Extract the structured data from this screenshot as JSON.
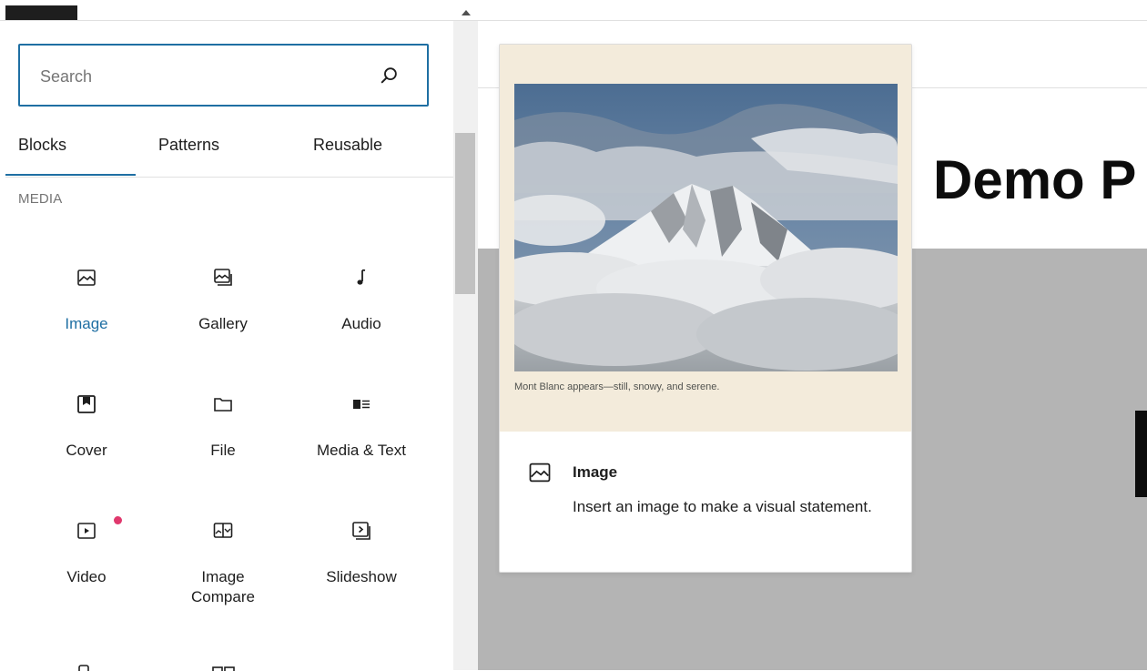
{
  "search": {
    "placeholder": "Search"
  },
  "tabs": [
    {
      "label": "Blocks",
      "active": true
    },
    {
      "label": "Patterns",
      "active": false
    },
    {
      "label": "Reusable",
      "active": false
    }
  ],
  "category": {
    "heading": "MEDIA"
  },
  "blocks": [
    {
      "label": "Image",
      "icon": "image-icon",
      "selected": true
    },
    {
      "label": "Gallery",
      "icon": "gallery-icon"
    },
    {
      "label": "Audio",
      "icon": "audio-icon"
    },
    {
      "label": "Cover",
      "icon": "cover-icon"
    },
    {
      "label": "File",
      "icon": "file-icon"
    },
    {
      "label": "Media & Text",
      "icon": "media-text-icon"
    },
    {
      "label": "Video",
      "icon": "video-icon",
      "badge": true
    },
    {
      "label": "Image\nCompare",
      "icon": "image-compare-icon"
    },
    {
      "label": "Slideshow",
      "icon": "slideshow-icon"
    }
  ],
  "editor": {
    "title": "Demo P"
  },
  "preview": {
    "caption": "Mont Blanc appears—still, snowy, and serene.",
    "name": "Image",
    "description": "Insert an image to make a visual statement."
  },
  "colors": {
    "accent": "#1f6fa3",
    "badge": "#e0386d",
    "preview_bg": "#f3ebdb",
    "canvas_gray": "#b4b4b4"
  }
}
